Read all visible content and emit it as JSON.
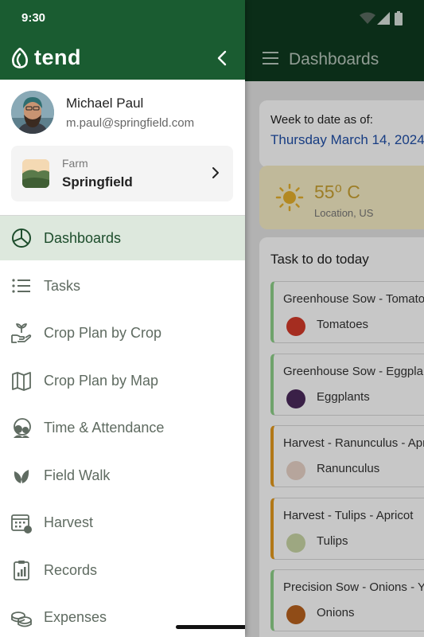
{
  "status_bar": {
    "time": "9:30"
  },
  "drawer": {
    "brand": "tend",
    "user": {
      "name": "Michael Paul",
      "email": "m.paul@springfield.com"
    },
    "farm": {
      "label": "Farm",
      "name": "Springfield"
    },
    "nav": [
      {
        "label": "Dashboards",
        "icon": "pie-chart-icon",
        "active": true
      },
      {
        "label": "Tasks",
        "icon": "list-icon"
      },
      {
        "label": "Crop Plan by Crop",
        "icon": "seedling-hand-icon"
      },
      {
        "label": "Crop Plan by Map",
        "icon": "map-icon"
      },
      {
        "label": "Time & Attendance",
        "icon": "people-clock-icon"
      },
      {
        "label": "Field Walk",
        "icon": "leaf-icon"
      },
      {
        "label": "Harvest",
        "icon": "calendar-harvest-icon"
      },
      {
        "label": "Records",
        "icon": "clipboard-chart-icon"
      },
      {
        "label": "Expenses",
        "icon": "coins-icon"
      }
    ]
  },
  "app": {
    "title": "Dashboards",
    "week": {
      "label": "Week to date as of:",
      "date": "Thursday March 14, 2024"
    },
    "weather": {
      "temp": "55⁰ C",
      "location": "Location, US"
    },
    "tasks": {
      "heading": "Task to do today",
      "items": [
        {
          "name": "Greenhouse Sow - Tomatoes",
          "crop": "Tomatoes",
          "accent": "#8fd18a",
          "crop_color": "#d43a2a"
        },
        {
          "name": "Greenhouse Sow - Eggplants",
          "crop": "Eggplants",
          "accent": "#8fd18a",
          "crop_color": "#4b2a5c"
        },
        {
          "name": "Harvest - Ranunculus - Apricot",
          "crop": "Ranunculus",
          "accent": "#e49a1e",
          "crop_color": "#e9d4c8"
        },
        {
          "name": "Harvest - Tulips - Apricot",
          "crop": "Tulips",
          "accent": "#e49a1e",
          "crop_color": "#c9d7a6"
        },
        {
          "name": "Precision Sow - Onions - Yellow",
          "crop": "Onions",
          "accent": "#8fd18a",
          "crop_color": "#b9621e"
        }
      ]
    }
  },
  "colors": {
    "brand_green": "#1a5c31",
    "active_bg": "#dde8dd",
    "date_blue": "#1f4fa8",
    "weather_yellow": "#c9a232"
  }
}
